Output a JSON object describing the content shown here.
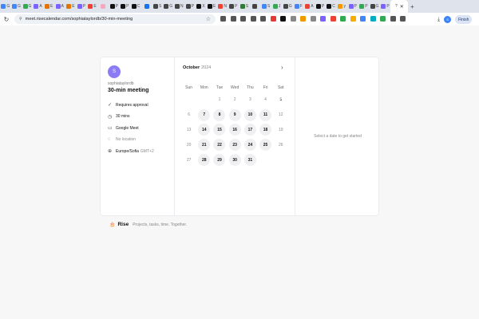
{
  "browser": {
    "tabs": [
      {
        "label": "G",
        "color": "#4285f4"
      },
      {
        "label": "G",
        "color": "#4285f4"
      },
      {
        "label": "G",
        "color": "#34a853"
      },
      {
        "label": "A",
        "color": "#7b61ff"
      },
      {
        "label": "E",
        "color": "#e37400"
      },
      {
        "label": "A",
        "color": "#7b61ff"
      },
      {
        "label": "E",
        "color": "#e37400"
      },
      {
        "label": "P",
        "color": "#7b61ff"
      },
      {
        "label": "E",
        "color": "#ea4335"
      },
      {
        "label": "",
        "color": "#f7a8c0"
      },
      {
        "label": "P",
        "color": "#111111"
      },
      {
        "label": "P",
        "color": "#111111"
      },
      {
        "label": "C",
        "color": "#111111"
      },
      {
        "label": "",
        "color": "#1a73e8"
      },
      {
        "label": "S",
        "color": "#444444"
      },
      {
        "label": "G",
        "color": "#444444"
      },
      {
        "label": "N",
        "color": "#444444"
      },
      {
        "label": "P",
        "color": "#444444"
      },
      {
        "label": "X",
        "color": "#111111"
      },
      {
        "label": "E",
        "color": "#111111"
      },
      {
        "label": "N",
        "color": "#ea4335"
      },
      {
        "label": "P",
        "color": "#444444"
      },
      {
        "label": "S",
        "color": "#2e7d32"
      },
      {
        "label": "",
        "color": "#444444"
      },
      {
        "label": "S",
        "color": "#4285f4"
      },
      {
        "label": "J",
        "color": "#34a853"
      },
      {
        "label": "G",
        "color": "#444444"
      },
      {
        "label": "F",
        "color": "#4285f4"
      },
      {
        "label": "A",
        "color": "#ea4335"
      },
      {
        "label": "P",
        "color": "#111111"
      },
      {
        "label": "C",
        "color": "#111111"
      },
      {
        "label": "y",
        "color": "#f29900"
      },
      {
        "label": "P",
        "color": "#7b61ff"
      },
      {
        "label": "P",
        "color": "#34a853"
      },
      {
        "label": "G",
        "color": "#444444"
      },
      {
        "label": "P",
        "color": "#7b61ff"
      }
    ],
    "active_tab_label": "?",
    "close_glyph": "✕",
    "new_tab_glyph": "+",
    "reload_glyph": "↻",
    "lock_glyph": "⚲",
    "url": "meet.risecalendar.com/sophiataylordb/30-min-meeting",
    "bookmark_glyph": "☆",
    "extension_colors": [
      "#555555",
      "#555555",
      "#555555",
      "#555555",
      "#555555",
      "#e53935",
      "#111111",
      "#888888",
      "#f29900",
      "#888888",
      "#7b61ff",
      "#ea4335",
      "#34a853",
      "#f9ab00",
      "#4285f4",
      "#00acc1",
      "#34a853",
      "#555555",
      "#555555"
    ],
    "download_glyph": "⤓",
    "profile_initial": "S",
    "finish_label": "Finish"
  },
  "booking": {
    "host_initial": "S",
    "host_name": "sophiataylordb",
    "meeting_title": "30-min meeting",
    "details": {
      "approval": "Requires approval",
      "duration": "30 mins",
      "platform": "Google Meet",
      "location": "No location",
      "timezone": "Europe/Sofia",
      "timezone_offset": "GMT+2"
    },
    "calendar": {
      "month": "October",
      "year": "2024",
      "next_glyph": "›",
      "weekdays": [
        "Sun",
        "Mon",
        "Tue",
        "Wed",
        "Thu",
        "Fri",
        "Sat"
      ],
      "weeks": [
        [
          {
            "d": ""
          },
          {
            "d": ""
          },
          {
            "d": "1"
          },
          {
            "d": "2"
          },
          {
            "d": "3"
          },
          {
            "d": "4"
          },
          {
            "d": "5",
            "today": true
          }
        ],
        [
          {
            "d": "6"
          },
          {
            "d": "7",
            "a": true
          },
          {
            "d": "8",
            "a": true
          },
          {
            "d": "9",
            "a": true
          },
          {
            "d": "10",
            "a": true
          },
          {
            "d": "11",
            "a": true
          },
          {
            "d": "12"
          }
        ],
        [
          {
            "d": "13"
          },
          {
            "d": "14",
            "a": true
          },
          {
            "d": "15",
            "a": true
          },
          {
            "d": "16",
            "a": true
          },
          {
            "d": "17",
            "a": true
          },
          {
            "d": "18",
            "a": true
          },
          {
            "d": "19"
          }
        ],
        [
          {
            "d": "20"
          },
          {
            "d": "21",
            "a": true
          },
          {
            "d": "22",
            "a": true
          },
          {
            "d": "23",
            "a": true
          },
          {
            "d": "24",
            "a": true
          },
          {
            "d": "25",
            "a": true
          },
          {
            "d": "26"
          }
        ],
        [
          {
            "d": "27"
          },
          {
            "d": "28",
            "a": true
          },
          {
            "d": "29",
            "a": true
          },
          {
            "d": "30",
            "a": true
          },
          {
            "d": "31",
            "a": true
          },
          {
            "d": ""
          },
          {
            "d": ""
          }
        ]
      ]
    },
    "hint": "Select a date to get started"
  },
  "footer": {
    "logo_glyph": "🎂",
    "brand": "Rise",
    "tagline": "Projects, tasks, time. Together."
  }
}
